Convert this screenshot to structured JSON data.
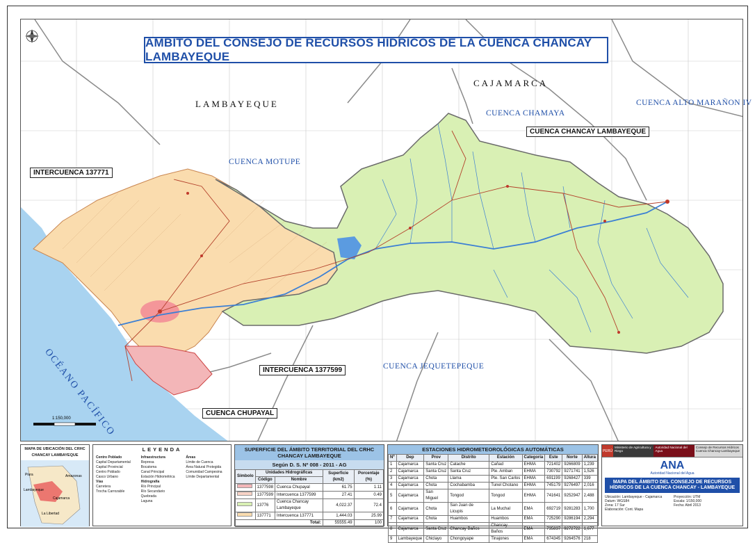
{
  "title": "AMBITO DEL CONSEJO DE RECURSOS HIDRICOS DE LA CUENCA CHANCAY LAMBAYEQUE",
  "departments": {
    "lambayeque": "LAMBAYEQUE",
    "cajamarca": "CAJAMARCA"
  },
  "basins": {
    "motupe": "CUENCA MOTUPE",
    "chamaya": "CUENCA CHAMAYA",
    "alto_maranon": "CUENCA ALTO MARAÑON IV",
    "jequetepeque": "CUENCA JEQUETEPEQUE",
    "chancay_box": "CUENCA CHANCAY LAMBAYEQUE",
    "intercuenca_1": "INTERCUENCA 137771",
    "intercuenca_2": "INTERCUENCA 1377599",
    "chupayal": "CUENCA CHUPAYAL"
  },
  "ocean": "OCÉANO PACÍFICO",
  "scale": {
    "label": "1:150,000",
    "ticks": [
      "0",
      "5",
      "10",
      "15"
    ]
  },
  "location_map": {
    "title": "MAPA DE UBICACIÓN DEL CRHC CHANCAY LAMBAYEQUE",
    "labels": [
      "Piura",
      "Amazonas",
      "Lambayeque",
      "Cajamarca",
      "La Libertad"
    ]
  },
  "legend": {
    "title": "LEYENDA",
    "groups": [
      "Centro Poblado",
      "Vías",
      "Hidrografía",
      "Infraestructura",
      "Áreas"
    ],
    "items": [
      "Capital Departamental",
      "Capital Provincial",
      "Centro Poblado",
      "Casco Urbano",
      "Carretera",
      "Trocha Carrozable",
      "Río Principal",
      "Río Secundario",
      "Quebrada",
      "Laguna",
      "Represa",
      "Bocatoma",
      "Canal Principal",
      "Estación Hidrométrica",
      "Límite de Cuenca",
      "Área Natural Protegida",
      "Comunidad Campesina",
      "Límite Departamental"
    ]
  },
  "surface_table": {
    "title": "SUPERFICIE DEL ÁMBITO TERRITORIAL DEL CRHC CHANCAY LAMBAYEQUE",
    "subtitle": "Según D. S. Nº 008 - 2011 - AG",
    "headers": [
      "Símbolo",
      "Código",
      "Nombre",
      "Superficie (km2)",
      "Porcentaje (%)"
    ],
    "group_header": "Unidades Hidrográficas",
    "rows": [
      {
        "code": "1377598",
        "name": "Cuenca Chupayal",
        "area": "61.75",
        "pct": "1.11",
        "color": "#f3b6b8"
      },
      {
        "code": "1377599",
        "name": "Intercuenca 1377599",
        "area": "27.41",
        "pct": "0.49",
        "color": "#f7d2c5"
      },
      {
        "code": "13776",
        "name": "Cuenca Chancay Lambayeque",
        "area": "4,022.37",
        "pct": "72.4",
        "color": "#d9f0b4"
      },
      {
        "code": "137771",
        "name": "Intercuenca 137771",
        "area": "1,444.03",
        "pct": "25.99",
        "color": "#fadcae"
      }
    ],
    "total_label": "Total:",
    "total_area": "55555.49",
    "total_pct": "100"
  },
  "stations_table": {
    "title": "ESTACIONES HIDROMETEOROLÓGICAS AUTOMÁTICAS",
    "headers": [
      "Nº",
      "Dep",
      "Prov",
      "Distrito",
      "Estación",
      "Categoría",
      "Este",
      "Norte",
      "Altura"
    ],
    "rows": [
      [
        "1",
        "Cajamarca",
        "Santa Cruz",
        "Catache",
        "Cañad",
        "EHMA",
        "721402",
        "9266809",
        "1,239"
      ],
      [
        "2",
        "Cajamarca",
        "Santa Cruz",
        "Santa Cruz",
        "Pte. Amban",
        "EHMA",
        "730792",
        "9271741",
        "1,526"
      ],
      [
        "3",
        "Cajamarca",
        "Chota",
        "Llama",
        "Pte. San Carlos",
        "EHMA",
        "691199",
        "9268427",
        "339"
      ],
      [
        "4",
        "Cajamarca",
        "Chota",
        "Cochabamba",
        "Tunel Chotano",
        "EHMA",
        "745179",
        "9276497",
        "2,016"
      ],
      [
        "5",
        "Cajamarca",
        "San Miguel",
        "Tongod",
        "Tongod",
        "EHMA",
        "741641",
        "9252947",
        "2,488"
      ],
      [
        "6",
        "Cajamarca",
        "Chota",
        "San Juan de Licupis",
        "La Muchal",
        "EMA",
        "692719",
        "9281283",
        "1,700"
      ],
      [
        "7",
        "Cajamarca",
        "Chota",
        "Huambos",
        "Huambos",
        "EMA",
        "725290",
        "9286194",
        "2,294"
      ],
      [
        "8",
        "Cajamarca",
        "Santa Cruz",
        "Chancay Baños",
        "Chancay Baños",
        "EMA",
        "735837",
        "9272722",
        "1,677"
      ],
      [
        "9",
        "Lambayeque",
        "Chiclayo",
        "Chongoyape",
        "Tinajones",
        "EMA",
        "674345",
        "9264576",
        "218"
      ]
    ]
  },
  "institution": {
    "peru": "PERÚ",
    "ministry": "Ministerio de Agricultura y Riego",
    "authority": "Autoridad Nacional del Agua",
    "council": "Consejo de Recursos Hídricos Cuenca Chancay-Lambayeque",
    "logo": "ANA",
    "logo_sub": "Autoridad Nacional del Agua",
    "map_title": "MAPA DEL ÁMBITO DEL CONSEJO DE RECURSOS HÍDRICOS DE LA CUENCA CHANCAY - LAMBAYEQUE",
    "meta": [
      "Ubicación: Lambayeque - Cajamarca",
      "Proyección: UTM",
      "Datum: WGS84",
      "Escala: 1/150,000",
      "Zona: 17 Sur",
      "Fecha: Abril 2013",
      "Elaboración: Cont. Mapa"
    ]
  },
  "colors": {
    "title_blue": "#1f4fa8",
    "chancay_basin": "#d9f0b4",
    "intercuenca": "#fadcae",
    "chupayal": "#f3b6b8",
    "sea": "#a9d3f0",
    "river": "#3b7fd4"
  }
}
